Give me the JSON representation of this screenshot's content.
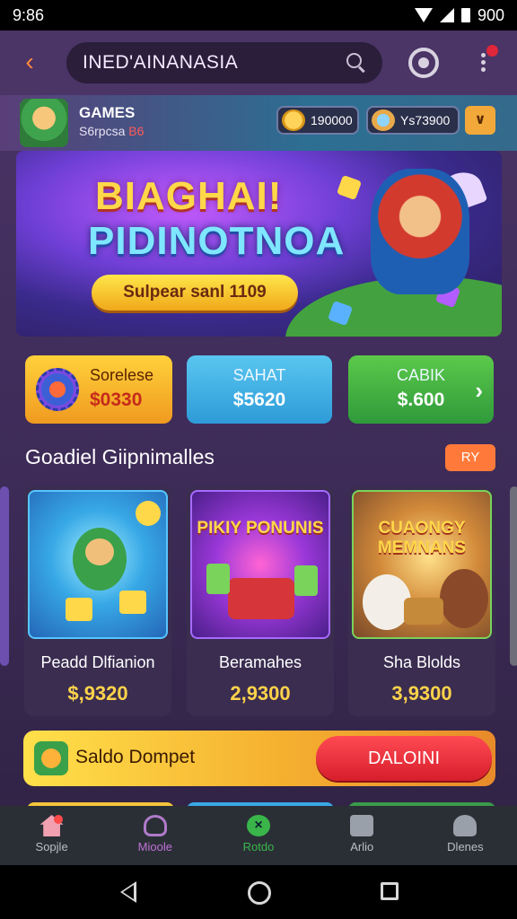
{
  "status_bar": {
    "time": "9:86",
    "right_text": "900"
  },
  "header": {
    "search_query": "INED'AINANASIA"
  },
  "profile": {
    "title": "GAMES",
    "subtitle_prefix": "S6rpcsa",
    "subtitle_highlight": "B6",
    "coins": "190000",
    "keys": "Ys73900"
  },
  "banner": {
    "title_line1": "BIAGHAI!",
    "title_line2": "PIDINOTNOA",
    "cta_label": "Sulpear sanl 1109"
  },
  "quick_cards": [
    {
      "label": "Sorelese",
      "value": "$0330"
    },
    {
      "label": "SAHAT",
      "value": "$5620"
    },
    {
      "label": "CABIK",
      "value": "$.600"
    }
  ],
  "section": {
    "title": "Goadiel Giipnimalles",
    "button_label": "RY"
  },
  "games": [
    {
      "art_text": "",
      "name": "Peadd Dlfianion",
      "price": "$,9320"
    },
    {
      "art_text": "PIKIY PONUNIS",
      "name": "Beramahes",
      "price": "2,9300"
    },
    {
      "art_text": "CUAONGY MEMNANS",
      "name": "Sha Blolds",
      "price": "3,9300"
    }
  ],
  "wallet": {
    "label": "Saldo Dompet",
    "button_label": "DALOINI"
  },
  "bottom_nav": [
    {
      "label": "Sopjle",
      "icon": "home-icon"
    },
    {
      "label": "Mioole",
      "icon": "user-icon"
    },
    {
      "label": "Rotdo",
      "icon": "play-icon"
    },
    {
      "label": "Arlio",
      "icon": "gift-icon"
    },
    {
      "label": "Dlenes",
      "icon": "profile-icon"
    }
  ],
  "colors": {
    "accent_orange": "#ff7a3a",
    "wallet_button": "#d61e2c",
    "nav_active": "#3ab54a"
  }
}
